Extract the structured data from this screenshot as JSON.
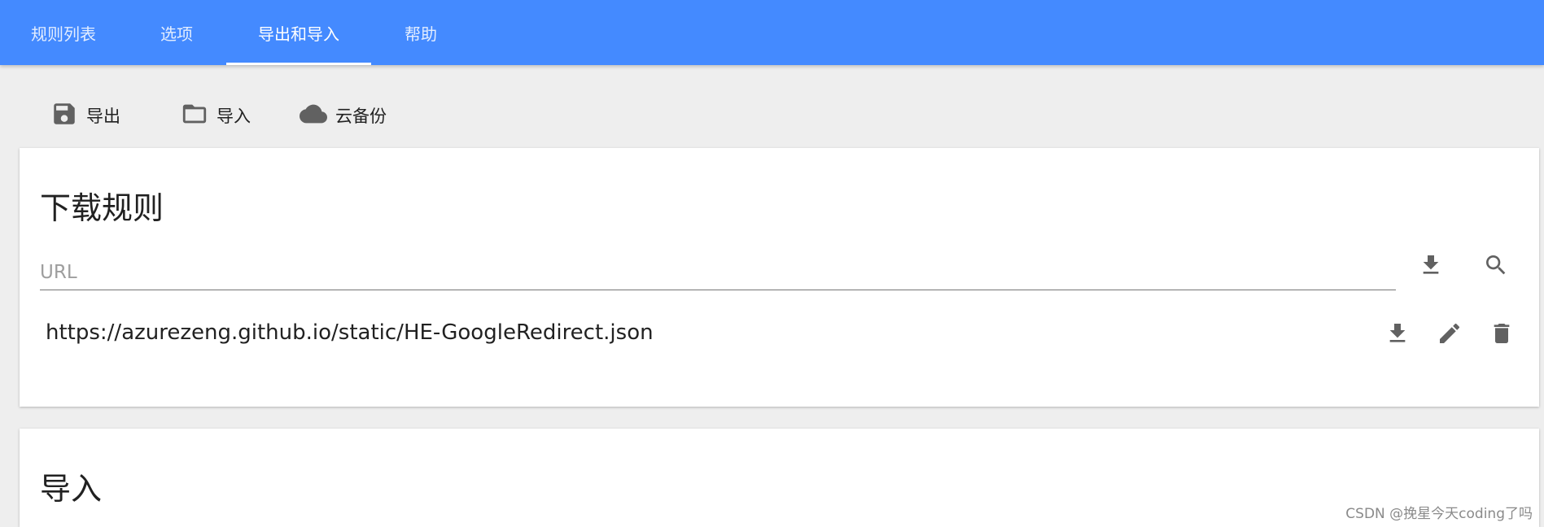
{
  "nav": {
    "tabs": [
      {
        "label": "规则列表",
        "active": false
      },
      {
        "label": "选项",
        "active": false
      },
      {
        "label": "导出和导入",
        "active": true
      },
      {
        "label": "帮助",
        "active": false
      }
    ]
  },
  "toolbar": {
    "export_label": "导出",
    "import_label": "导入",
    "cloud_backup_label": "云备份"
  },
  "download_rules": {
    "title": "下载规则",
    "url_placeholder": "URL",
    "url_value": "",
    "rules": [
      {
        "url": "https://azurezeng.github.io/static/HE-GoogleRedirect.json"
      }
    ]
  },
  "import_section": {
    "title": "导入"
  },
  "watermark": "CSDN @挽星今天coding了吗",
  "colors": {
    "primary": "#448aff",
    "background": "#eeeeee",
    "icon": "#616161"
  },
  "icons": [
    "save-icon",
    "folder-icon",
    "cloud-icon",
    "download-icon",
    "search-icon",
    "edit-icon",
    "delete-icon"
  ]
}
